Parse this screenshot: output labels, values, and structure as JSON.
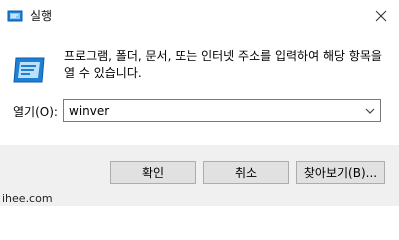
{
  "window": {
    "title": "실행",
    "title_icon": "run-app-icon",
    "close_icon": "close-icon"
  },
  "content": {
    "icon": "run-dialog-icon",
    "description": "프로그램, 폴더, 문서, 또는 인터넷 주소를 입력하여 해당 항목을 열 수 있습니다.",
    "open_label": "열기(O):",
    "open_value": "winver"
  },
  "buttons": {
    "ok": "확인",
    "cancel": "취소",
    "browse": "찾아보기(B)..."
  },
  "watermark": "ihee.com",
  "colors": {
    "footer_bg": "#f0f0f0",
    "button_bg": "#e1e1e1",
    "button_border": "#adadad",
    "icon_blue": "#1e7fd6"
  }
}
